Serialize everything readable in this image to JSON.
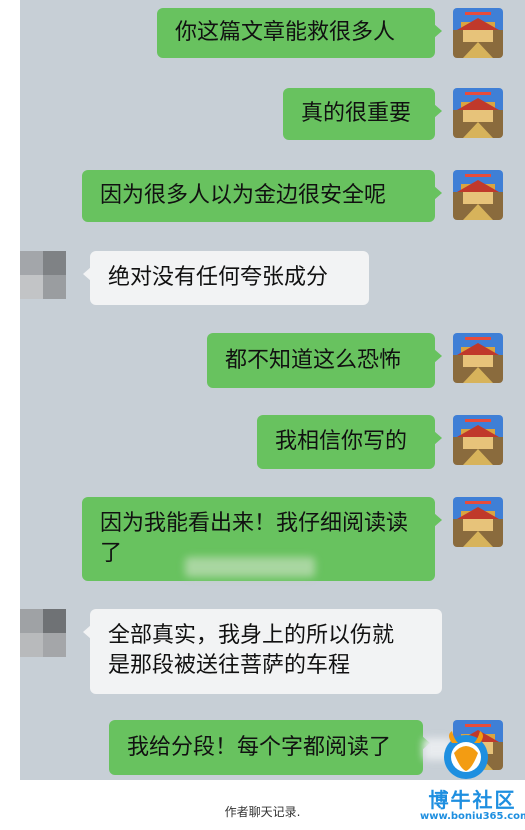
{
  "messages": [
    {
      "side": "right",
      "text": "你这篇文章能救很多人"
    },
    {
      "side": "right",
      "text": "真的很重要"
    },
    {
      "side": "right",
      "text": "因为很多人以为金边很安全呢"
    },
    {
      "side": "left",
      "text": "绝对没有任何夸张成分"
    },
    {
      "side": "right",
      "text": "都不知道这么恐怖"
    },
    {
      "side": "right",
      "text": "我相信你写的"
    },
    {
      "side": "right",
      "lines": [
        "因为我能看出来！我仔细阅读读",
        "了"
      ]
    },
    {
      "side": "left",
      "lines": [
        "全部真实，我身上的所以伤就",
        "是那段被送往菩萨的车程"
      ]
    },
    {
      "side": "right",
      "text": "我给分段！每个字都阅读了"
    }
  ],
  "caption": "作者聊天记录.",
  "watermark": {
    "name": "博牛社区",
    "url": "www.boniu365.com"
  },
  "colors": {
    "chat_background": "#c7cfd6",
    "outgoing_bubble": "#68c25f",
    "incoming_bubble": "#f2f3f4",
    "watermark": "#1e8fe0"
  },
  "avatar": {
    "outgoing": "palace-photo-icon",
    "incoming": "pixelated-avatar-icon"
  }
}
